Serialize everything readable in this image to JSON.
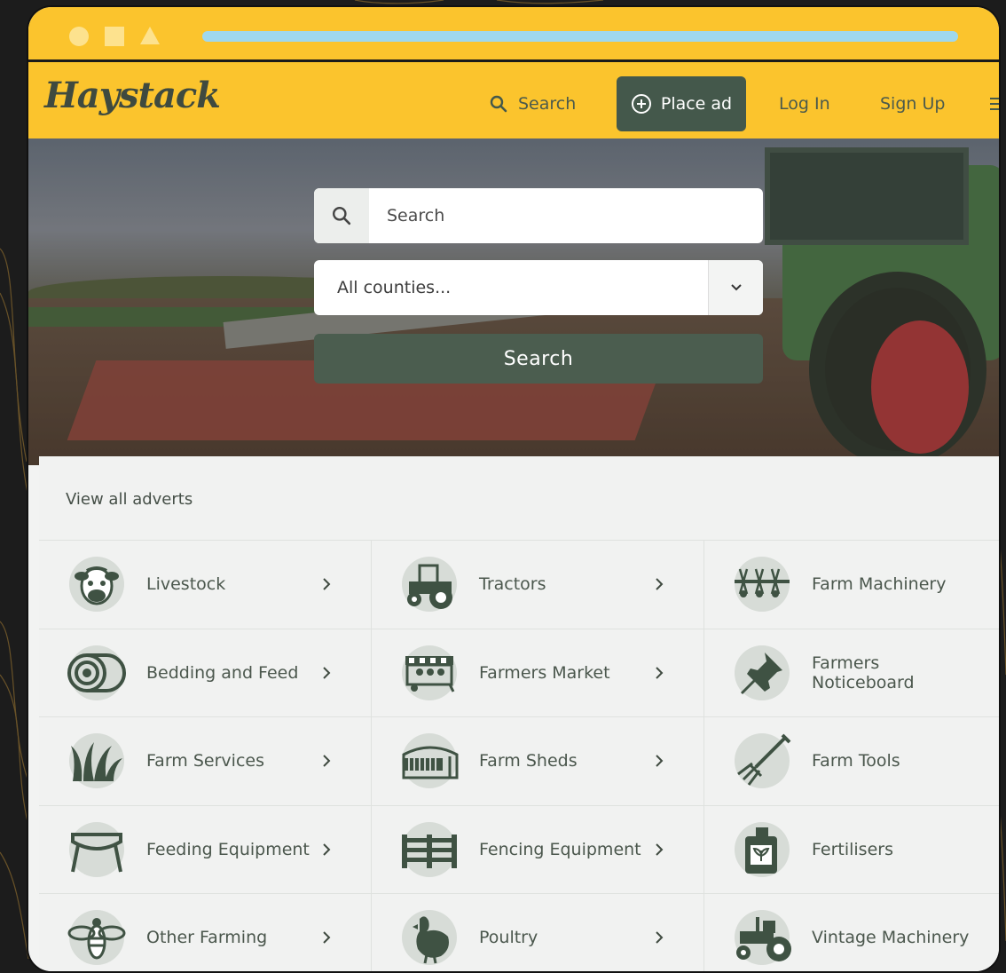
{
  "nav": {
    "logo": "Haystack",
    "search_label": "Search",
    "place_ad_label": "Place ad",
    "login_label": "Log In",
    "signup_label": "Sign Up"
  },
  "hero": {
    "search_placeholder": "Search",
    "county_value": "All counties...",
    "search_button": "Search"
  },
  "categories": {
    "view_all": "View all adverts",
    "items": [
      {
        "label": "Livestock",
        "icon": "cow-icon"
      },
      {
        "label": "Tractors",
        "icon": "tractor-icon"
      },
      {
        "label": "Farm Machinery",
        "icon": "tedder-icon"
      },
      {
        "label": "Bedding and Feed",
        "icon": "hay-bale-icon"
      },
      {
        "label": "Farmers Market",
        "icon": "market-stall-icon"
      },
      {
        "label": "Farmers Noticeboard",
        "icon": "pushpin-icon"
      },
      {
        "label": "Farm Services",
        "icon": "grass-icon"
      },
      {
        "label": "Farm Sheds",
        "icon": "shed-icon"
      },
      {
        "label": "Farm Tools",
        "icon": "pitchfork-icon"
      },
      {
        "label": "Feeding Equipment",
        "icon": "feeder-icon"
      },
      {
        "label": "Fencing Equipment",
        "icon": "fence-icon"
      },
      {
        "label": "Fertilisers",
        "icon": "fertiliser-icon"
      },
      {
        "label": "Other Farming",
        "icon": "bee-icon"
      },
      {
        "label": "Poultry",
        "icon": "chicken-icon"
      },
      {
        "label": "Vintage Machinery",
        "icon": "vintage-tractor-icon"
      }
    ]
  },
  "colors": {
    "brand_yellow": "#fbc42d",
    "brand_green": "#44584b",
    "icon_green": "#3f5243",
    "icon_circle": "#d7dcd7"
  }
}
